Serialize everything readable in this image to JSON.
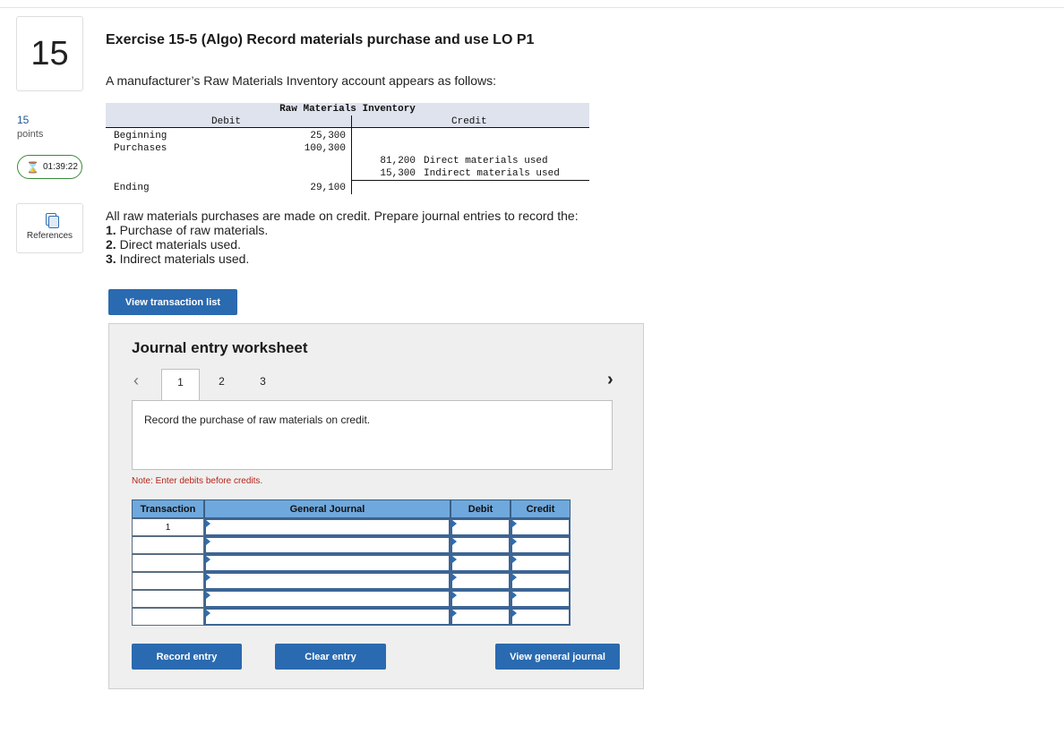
{
  "question": {
    "number": "15",
    "points_value": "15",
    "points_label": "points",
    "timer": "01:39:22",
    "references_label": "References"
  },
  "exercise": {
    "title": "Exercise 15-5 (Algo) Record materials purchase and use LO P1",
    "intro": "A manufacturer’s Raw Materials Inventory account appears as follows:"
  },
  "t_account": {
    "title": "Raw Materials Inventory",
    "debit_header": "Debit",
    "credit_header": "Credit",
    "beginning_label": "Beginning",
    "beginning_value": "25,300",
    "purchases_label": "Purchases",
    "purchases_value": "100,300",
    "credit_row1_value": "81,200",
    "credit_row1_label": "Direct materials used",
    "credit_row2_value": "15,300",
    "credit_row2_label": "Indirect materials used",
    "ending_label": "Ending",
    "ending_value": "29,100"
  },
  "instructions": {
    "lead": "All raw materials purchases are made on credit. Prepare journal entries to record the:",
    "items": [
      {
        "num": "1.",
        "text": "Purchase of raw materials."
      },
      {
        "num": "2.",
        "text": "Direct materials used."
      },
      {
        "num": "3.",
        "text": "Indirect materials used."
      }
    ]
  },
  "view_transaction_list_label": "View transaction list",
  "worksheet": {
    "title": "Journal entry worksheet",
    "tabs": [
      "1",
      "2",
      "3"
    ],
    "active_tab": "1",
    "prompt": "Record the purchase of raw materials on credit.",
    "note": "Note: Enter debits before credits.",
    "columns": {
      "transaction": "Transaction",
      "general_journal": "General Journal",
      "debit": "Debit",
      "credit": "Credit"
    },
    "rows": [
      {
        "transaction": "1",
        "account": "",
        "debit": "",
        "credit": ""
      },
      {
        "transaction": "",
        "account": "",
        "debit": "",
        "credit": ""
      },
      {
        "transaction": "",
        "account": "",
        "debit": "",
        "credit": ""
      },
      {
        "transaction": "",
        "account": "",
        "debit": "",
        "credit": ""
      },
      {
        "transaction": "",
        "account": "",
        "debit": "",
        "credit": ""
      },
      {
        "transaction": "",
        "account": "",
        "debit": "",
        "credit": ""
      }
    ],
    "record_entry_label": "Record entry",
    "clear_entry_label": "Clear entry",
    "view_general_journal_label": "View general journal"
  },
  "colors": {
    "primary_button": "#2a6ab0",
    "table_header": "#6fa8dc",
    "note_red": "#b3251a",
    "timer_green": "#3a8a3a",
    "link_blue": "#1f5a99"
  },
  "icons": {
    "timer": "hourglass-icon",
    "references": "documents-icon",
    "prev": "chevron-left-icon",
    "next": "chevron-right-icon"
  }
}
